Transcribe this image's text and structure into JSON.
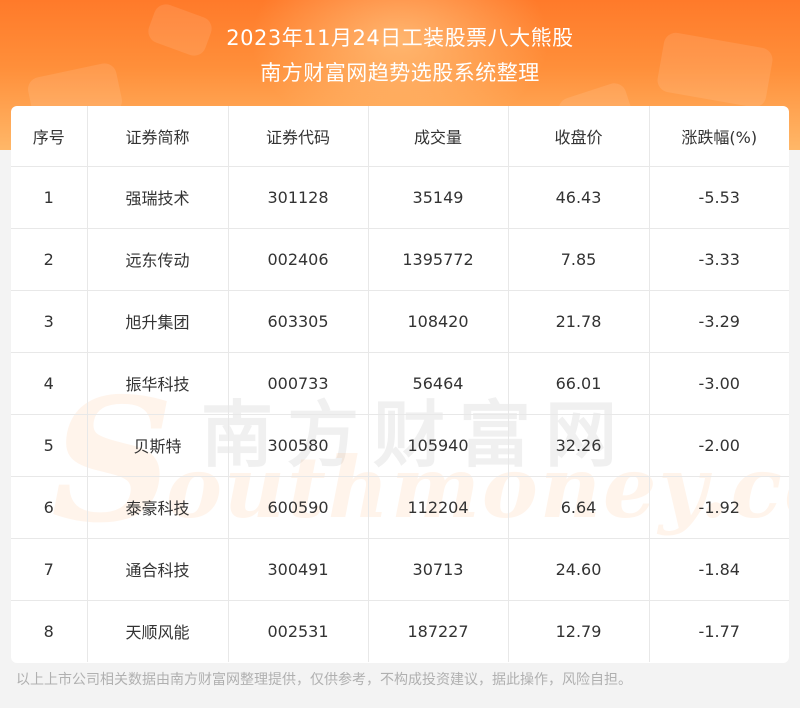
{
  "header": {
    "title_line1": "2023年11月24日工装股票八大熊股",
    "title_line2": "南方财富网趋势选股系统整理"
  },
  "table": {
    "columns": [
      "序号",
      "证券简称",
      "证券代码",
      "成交量",
      "收盘价",
      "涨跌幅(%)"
    ],
    "rows": [
      [
        "1",
        "强瑞技术",
        "301128",
        "35149",
        "46.43",
        "-5.53"
      ],
      [
        "2",
        "远东传动",
        "002406",
        "1395772",
        "7.85",
        "-3.33"
      ],
      [
        "3",
        "旭升集团",
        "603305",
        "108420",
        "21.78",
        "-3.29"
      ],
      [
        "4",
        "振华科技",
        "000733",
        "56464",
        "66.01",
        "-3.00"
      ],
      [
        "5",
        "贝斯特",
        "300580",
        "105940",
        "32.26",
        "-2.00"
      ],
      [
        "6",
        "泰豪科技",
        "600590",
        "112204",
        "6.64",
        "-1.92"
      ],
      [
        "7",
        "通合科技",
        "300491",
        "30713",
        "24.60",
        "-1.84"
      ],
      [
        "8",
        "天顺风能",
        "002531",
        "187227",
        "12.79",
        "-1.77"
      ]
    ]
  },
  "watermark": {
    "chinese": "南方财富网",
    "english": "outhmoney.com",
    "letter": "S"
  },
  "footer": {
    "disclaimer": "以上上市公司相关数据由南方财富网整理提供，仅供参考，不构成投资建议，据此操作，风险自担。"
  },
  "colors": {
    "header_orange": "#ff7a2a",
    "header_light": "#ffb768",
    "text": "#333333",
    "footer_text": "#b0b0b0"
  }
}
